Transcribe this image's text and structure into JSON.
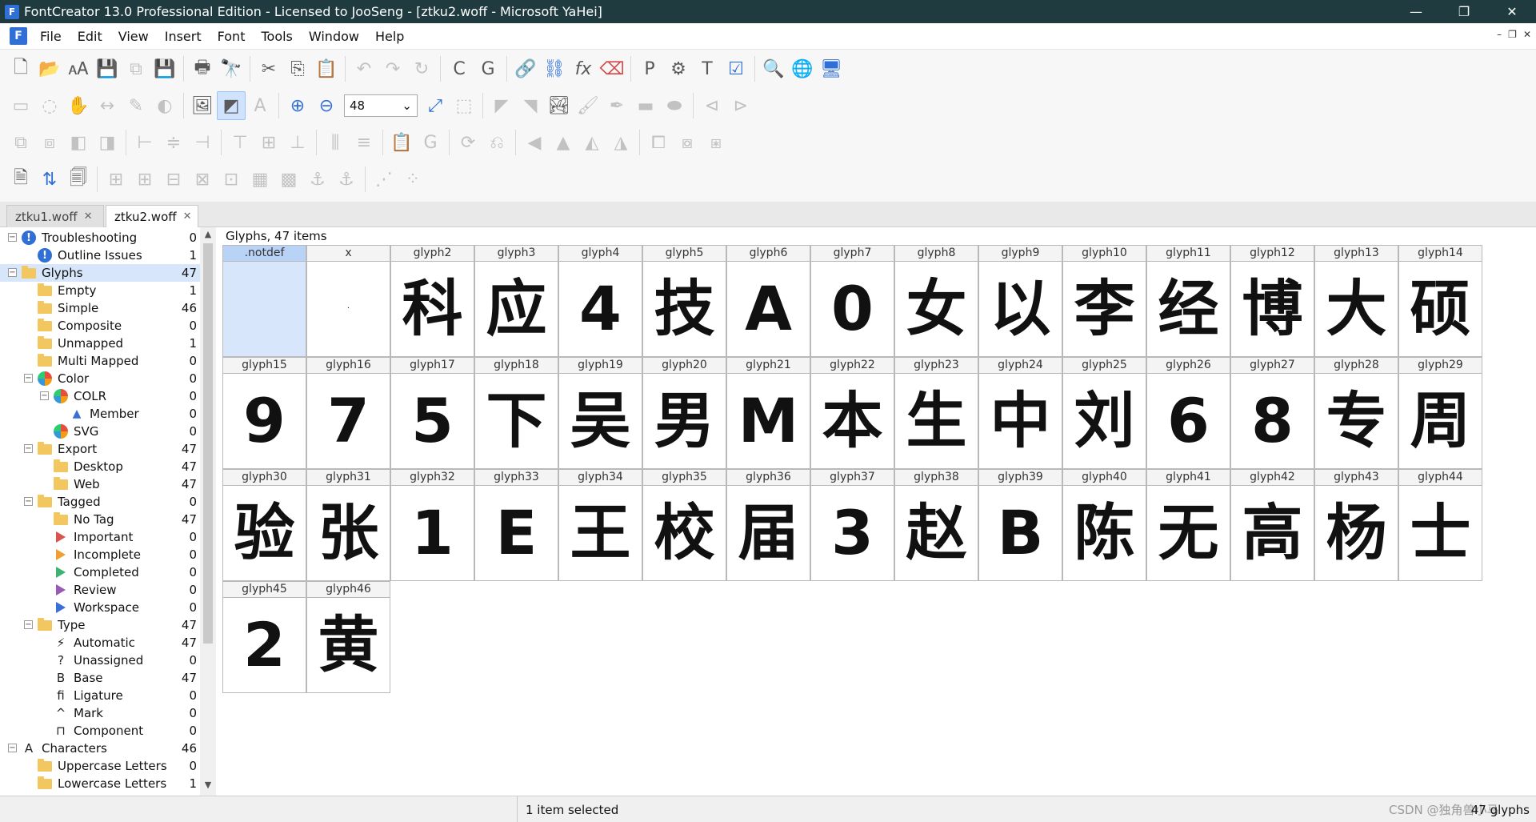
{
  "window": {
    "title": "FontCreator 13.0 Professional Edition - Licensed to JooSeng - [ztku2.woff - Microsoft YaHei]",
    "app_icon": "F",
    "minimize": "—",
    "restore": "❐",
    "close": "✕"
  },
  "menu": [
    "File",
    "Edit",
    "View",
    "Insert",
    "Font",
    "Tools",
    "Window",
    "Help"
  ],
  "mdi_controls": {
    "minimize": "–",
    "restore": "❐",
    "close": "✕"
  },
  "toolbar": {
    "zoom_value": "48"
  },
  "tabs": [
    {
      "label": "ztku1.woff",
      "close": "✕",
      "active": false
    },
    {
      "label": "ztku2.woff",
      "close": "✕",
      "active": true
    }
  ],
  "tree": [
    {
      "label": "Troubleshooting",
      "count": "0",
      "level": 0,
      "icon": "warning-icon",
      "exp": "⊟"
    },
    {
      "label": "Outline Issues",
      "count": "1",
      "level": 1,
      "icon": "warning-icon"
    },
    {
      "label": "Glyphs",
      "count": "47",
      "level": 0,
      "icon": "folder-icon",
      "exp": "⊟",
      "selected": true
    },
    {
      "label": "Empty",
      "count": "1",
      "level": 1,
      "icon": "folder-icon"
    },
    {
      "label": "Simple",
      "count": "46",
      "level": 1,
      "icon": "folder-icon"
    },
    {
      "label": "Composite",
      "count": "0",
      "level": 1,
      "icon": "folder-icon"
    },
    {
      "label": "Unmapped",
      "count": "1",
      "level": 1,
      "icon": "folder-icon"
    },
    {
      "label": "Multi Mapped",
      "count": "0",
      "level": 1,
      "icon": "folder-icon"
    },
    {
      "label": "Color",
      "count": "0",
      "level": 1,
      "icon": "palette-icon",
      "exp": "⊟"
    },
    {
      "label": "COLR",
      "count": "0",
      "level": 2,
      "icon": "palette-icon",
      "exp": "⊟"
    },
    {
      "label": "Member",
      "count": "0",
      "level": 3,
      "icon": "triangle-icon"
    },
    {
      "label": "SVG",
      "count": "0",
      "level": 2,
      "icon": "palette-icon"
    },
    {
      "label": "Export",
      "count": "47",
      "level": 1,
      "icon": "folder-icon",
      "exp": "⊟"
    },
    {
      "label": "Desktop",
      "count": "47",
      "level": 2,
      "icon": "folder-icon"
    },
    {
      "label": "Web",
      "count": "47",
      "level": 2,
      "icon": "folder-icon"
    },
    {
      "label": "Tagged",
      "count": "0",
      "level": 1,
      "icon": "folder-icon",
      "exp": "⊟"
    },
    {
      "label": "No Tag",
      "count": "47",
      "level": 2,
      "icon": "folder-icon"
    },
    {
      "label": "Important",
      "count": "0",
      "level": 2,
      "icon": "flag-icon",
      "color": "#d9534f"
    },
    {
      "label": "Incomplete",
      "count": "0",
      "level": 2,
      "icon": "flag-icon",
      "color": "#f0a030"
    },
    {
      "label": "Completed",
      "count": "0",
      "level": 2,
      "icon": "flag-icon",
      "color": "#3cb371"
    },
    {
      "label": "Review",
      "count": "0",
      "level": 2,
      "icon": "flag-icon",
      "color": "#9b59b6"
    },
    {
      "label": "Workspace",
      "count": "0",
      "level": 2,
      "icon": "flag-icon",
      "color": "#3a6fd8"
    },
    {
      "label": "Type",
      "count": "47",
      "level": 1,
      "icon": "folder-icon",
      "exp": "⊟"
    },
    {
      "label": "Automatic",
      "count": "47",
      "level": 2,
      "icon": "lightning-icon",
      "glyph": "⚡"
    },
    {
      "label": "Unassigned",
      "count": "0",
      "level": 2,
      "icon": "question-icon",
      "glyph": "?"
    },
    {
      "label": "Base",
      "count": "47",
      "level": 2,
      "icon": "base-icon",
      "glyph": "B"
    },
    {
      "label": "Ligature",
      "count": "0",
      "level": 2,
      "icon": "ligature-icon",
      "glyph": "fi"
    },
    {
      "label": "Mark",
      "count": "0",
      "level": 2,
      "icon": "mark-icon",
      "glyph": "^"
    },
    {
      "label": "Component",
      "count": "0",
      "level": 2,
      "icon": "component-icon",
      "glyph": "⊓"
    },
    {
      "label": "Characters",
      "count": "46",
      "level": 0,
      "icon": "characters-icon",
      "glyph": "A",
      "exp": "⊟"
    },
    {
      "label": "Uppercase Letters",
      "count": "0",
      "level": 1,
      "icon": "folder-icon"
    },
    {
      "label": "Lowercase Letters",
      "count": "1",
      "level": 1,
      "icon": "folder-icon"
    }
  ],
  "scroll": {
    "up": "▲",
    "down": "▼"
  },
  "glyphs_title": "Glyphs, 47 items",
  "glyphs": [
    {
      "name": ".notdef",
      "char": "",
      "selected": true
    },
    {
      "name": "x",
      "char": "·"
    },
    {
      "name": "glyph2",
      "char": "科"
    },
    {
      "name": "glyph3",
      "char": "应"
    },
    {
      "name": "glyph4",
      "char": "4"
    },
    {
      "name": "glyph5",
      "char": "技"
    },
    {
      "name": "glyph6",
      "char": "A"
    },
    {
      "name": "glyph7",
      "char": "0"
    },
    {
      "name": "glyph8",
      "char": "女"
    },
    {
      "name": "glyph9",
      "char": "以"
    },
    {
      "name": "glyph10",
      "char": "李"
    },
    {
      "name": "glyph11",
      "char": "经"
    },
    {
      "name": "glyph12",
      "char": "博"
    },
    {
      "name": "glyph13",
      "char": "大"
    },
    {
      "name": "glyph14",
      "char": "硕"
    },
    {
      "name": "glyph15",
      "char": "9"
    },
    {
      "name": "glyph16",
      "char": "7"
    },
    {
      "name": "glyph17",
      "char": "5"
    },
    {
      "name": "glyph18",
      "char": "下"
    },
    {
      "name": "glyph19",
      "char": "吴"
    },
    {
      "name": "glyph20",
      "char": "男"
    },
    {
      "name": "glyph21",
      "char": "M"
    },
    {
      "name": "glyph22",
      "char": "本"
    },
    {
      "name": "glyph23",
      "char": "生"
    },
    {
      "name": "glyph24",
      "char": "中"
    },
    {
      "name": "glyph25",
      "char": "刘"
    },
    {
      "name": "glyph26",
      "char": "6"
    },
    {
      "name": "glyph27",
      "char": "8"
    },
    {
      "name": "glyph28",
      "char": "专"
    },
    {
      "name": "glyph29",
      "char": "周"
    },
    {
      "name": "glyph30",
      "char": "验"
    },
    {
      "name": "glyph31",
      "char": "张"
    },
    {
      "name": "glyph32",
      "char": "1"
    },
    {
      "name": "glyph33",
      "char": "E"
    },
    {
      "name": "glyph34",
      "char": "王"
    },
    {
      "name": "glyph35",
      "char": "校"
    },
    {
      "name": "glyph36",
      "char": "届"
    },
    {
      "name": "glyph37",
      "char": "3"
    },
    {
      "name": "glyph38",
      "char": "赵"
    },
    {
      "name": "glyph39",
      "char": "B"
    },
    {
      "name": "glyph40",
      "char": "陈"
    },
    {
      "name": "glyph41",
      "char": "无"
    },
    {
      "name": "glyph42",
      "char": "高"
    },
    {
      "name": "glyph43",
      "char": "杨"
    },
    {
      "name": "glyph44",
      "char": "士"
    },
    {
      "name": "glyph45",
      "char": "2"
    },
    {
      "name": "glyph46",
      "char": "黄"
    }
  ],
  "status": {
    "selection": "1 item selected",
    "watermark": "CSDN @独角兽小马",
    "glyph_count": "47 glyphs"
  }
}
